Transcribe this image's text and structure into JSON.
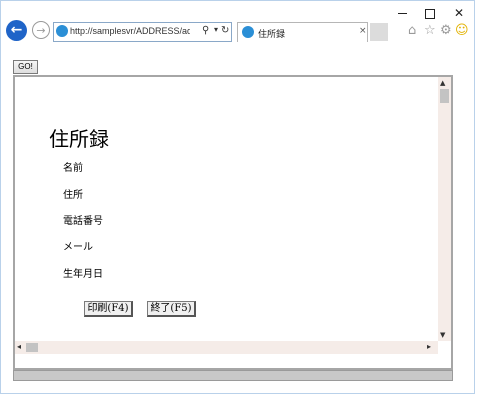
{
  "browser": {
    "address": "http://samplesvr/ADDRESS/address.ht",
    "tab_title": "住所録",
    "tab_close": "×",
    "icons": [
      "back-arrow-icon",
      "forward-arrow-icon",
      "search-icon",
      "dropdown-icon",
      "refresh-icon",
      "home-icon",
      "star-icon",
      "gear-icon",
      "smiley-icon"
    ]
  },
  "page": {
    "go_label": "GO!",
    "title": "住所録",
    "fields": [
      "名前",
      "住所",
      "電話番号",
      "メール",
      "生年月日"
    ],
    "print_label": "印刷(F4)",
    "exit_label": "終了(F5)"
  }
}
